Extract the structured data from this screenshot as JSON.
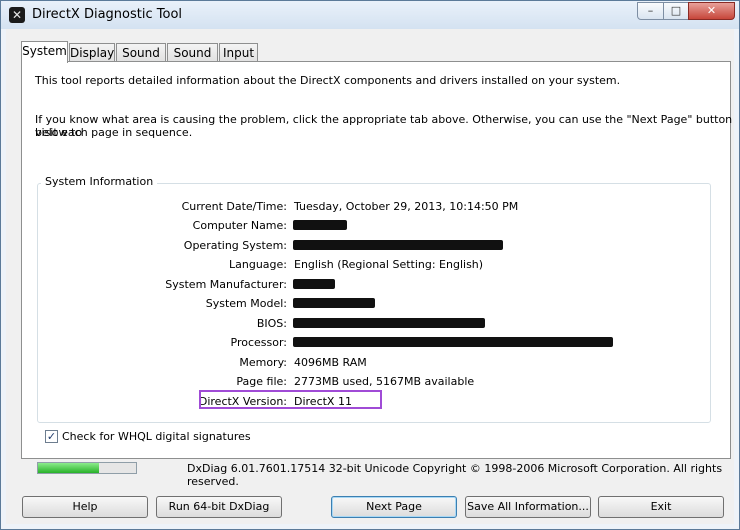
{
  "window": {
    "title": "DirectX Diagnostic Tool"
  },
  "caption_buttons": {
    "minimize": "–",
    "maximize": "□",
    "close": "✕"
  },
  "tabs": [
    {
      "label": "System",
      "active": true
    },
    {
      "label": "Display",
      "active": false
    },
    {
      "label": "Sound 1",
      "active": false
    },
    {
      "label": "Sound 2",
      "active": false
    },
    {
      "label": "Input",
      "active": false
    }
  ],
  "intro": {
    "line1": "This tool reports detailed information about the DirectX components and drivers installed on your system.",
    "line2a": "If you know what area is causing the problem, click the appropriate tab above.  Otherwise, you can use the \"Next Page\" button below to",
    "line2b": "visit each page in sequence."
  },
  "system_info": {
    "group_label": "System Information",
    "rows": [
      {
        "label": "Current Date/Time:",
        "value": "Tuesday, October 29, 2013, 10:14:50 PM"
      },
      {
        "label": "Computer Name:",
        "value": ""
      },
      {
        "label": "Operating System:",
        "value": ""
      },
      {
        "label": "Language:",
        "value": "English (Regional Setting: English)"
      },
      {
        "label": "System Manufacturer:",
        "value": ""
      },
      {
        "label": "System Model:",
        "value": ""
      },
      {
        "label": "BIOS:",
        "value": ""
      },
      {
        "label": "Processor:",
        "value": ""
      },
      {
        "label": "Memory:",
        "value": "4096MB RAM"
      },
      {
        "label": "Page file:",
        "value": "2773MB used, 5167MB available"
      },
      {
        "label": "DirectX Version:",
        "value": "DirectX 11"
      }
    ]
  },
  "whql": {
    "label": "Check for WHQL digital signatures",
    "checked": true
  },
  "progress": {
    "fraction": 0.62,
    "color": "#28b128"
  },
  "footer": {
    "text": "DxDiag 6.01.7601.17514 32-bit Unicode  Copyright © 1998-2006 Microsoft Corporation.  All rights reserved."
  },
  "buttons": {
    "help": "Help",
    "run64": "Run 64-bit DxDiag",
    "next": "Next Page",
    "save": "Save All Information...",
    "exit": "Exit"
  },
  "colors": {
    "highlight_border": "#a04bd6",
    "redaction": "#111111"
  }
}
